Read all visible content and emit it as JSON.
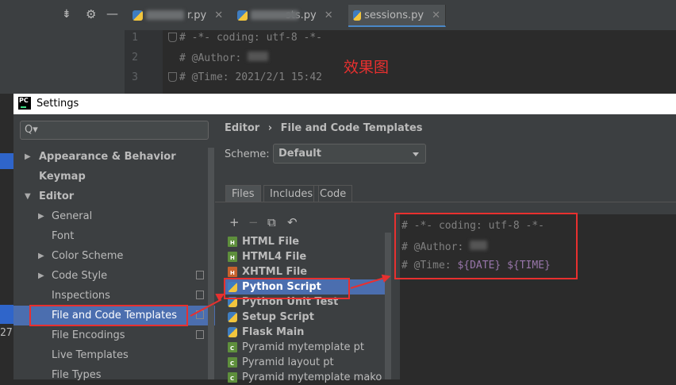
{
  "editor": {
    "tabs": [
      {
        "label": "r.py",
        "active": false
      },
      {
        "label": "sts.py",
        "active": false
      },
      {
        "label": "sessions.py",
        "active": true
      }
    ],
    "line_numbers": [
      "1",
      "2",
      "3"
    ],
    "lines": [
      "# -*- coding: utf-8 -*-",
      "# @Author:",
      "# @Time: 2021/2/1 15:42"
    ]
  },
  "annotation": "效果图",
  "settings": {
    "window_title": "Settings",
    "search_placeholder": "Q▾",
    "tree": [
      {
        "label": "Appearance & Behavior",
        "level": 0,
        "bold": true,
        "arrow": "▶"
      },
      {
        "label": "Keymap",
        "level": 0,
        "bold": true,
        "arrow": ""
      },
      {
        "label": "Editor",
        "level": 0,
        "bold": true,
        "arrow": "▼"
      },
      {
        "label": "General",
        "level": 1,
        "arrow": "▶"
      },
      {
        "label": "Font",
        "level": 1,
        "arrow": ""
      },
      {
        "label": "Color Scheme",
        "level": 1,
        "arrow": "▶"
      },
      {
        "label": "Code Style",
        "level": 1,
        "arrow": "▶",
        "copy": true
      },
      {
        "label": "Inspections",
        "level": 1,
        "arrow": "",
        "copy": true
      },
      {
        "label": "File and Code Templates",
        "level": 1,
        "arrow": "",
        "copy": true,
        "selected": true
      },
      {
        "label": "File Encodings",
        "level": 1,
        "arrow": "",
        "copy": true
      },
      {
        "label": "Live Templates",
        "level": 1,
        "arrow": ""
      },
      {
        "label": "File Types",
        "level": 1,
        "arrow": ""
      }
    ],
    "breadcrumb": {
      "parent": "Editor",
      "separator": "›",
      "current": "File and Code Templates"
    },
    "scheme_label": "Scheme:",
    "scheme_value": "Default",
    "tabs": [
      "Files",
      "Includes",
      "Code"
    ],
    "toolbar": [
      "+",
      "−",
      "⧉",
      "↶"
    ],
    "templates": [
      {
        "label": "HTML File",
        "icon": "H",
        "bold": true
      },
      {
        "label": "HTML4 File",
        "icon": "H",
        "bold": true
      },
      {
        "label": "XHTML File",
        "icon": "H",
        "bold": true
      },
      {
        "label": "Python Script",
        "icon": "py",
        "bold": true,
        "selected": true
      },
      {
        "label": "Python Unit Test",
        "icon": "py",
        "bold": true
      },
      {
        "label": "Setup Script",
        "icon": "py",
        "bold": true
      },
      {
        "label": "Flask Main",
        "icon": "py",
        "bold": true
      },
      {
        "label": "Pyramid mytemplate pt",
        "icon": "C",
        "bold": false
      },
      {
        "label": "Pyramid layout pt",
        "icon": "C",
        "bold": false
      },
      {
        "label": "Pyramid mytemplate mako",
        "icon": "C",
        "bold": false
      }
    ],
    "template_code": {
      "line1": "# -*- coding: utf-8 -*-",
      "line2": "# @Author:",
      "line3_prefix": "# @Time: ",
      "line3_date": "${DATE}",
      "line3_time": "${TIME}"
    }
  },
  "left_edge_number": "27"
}
